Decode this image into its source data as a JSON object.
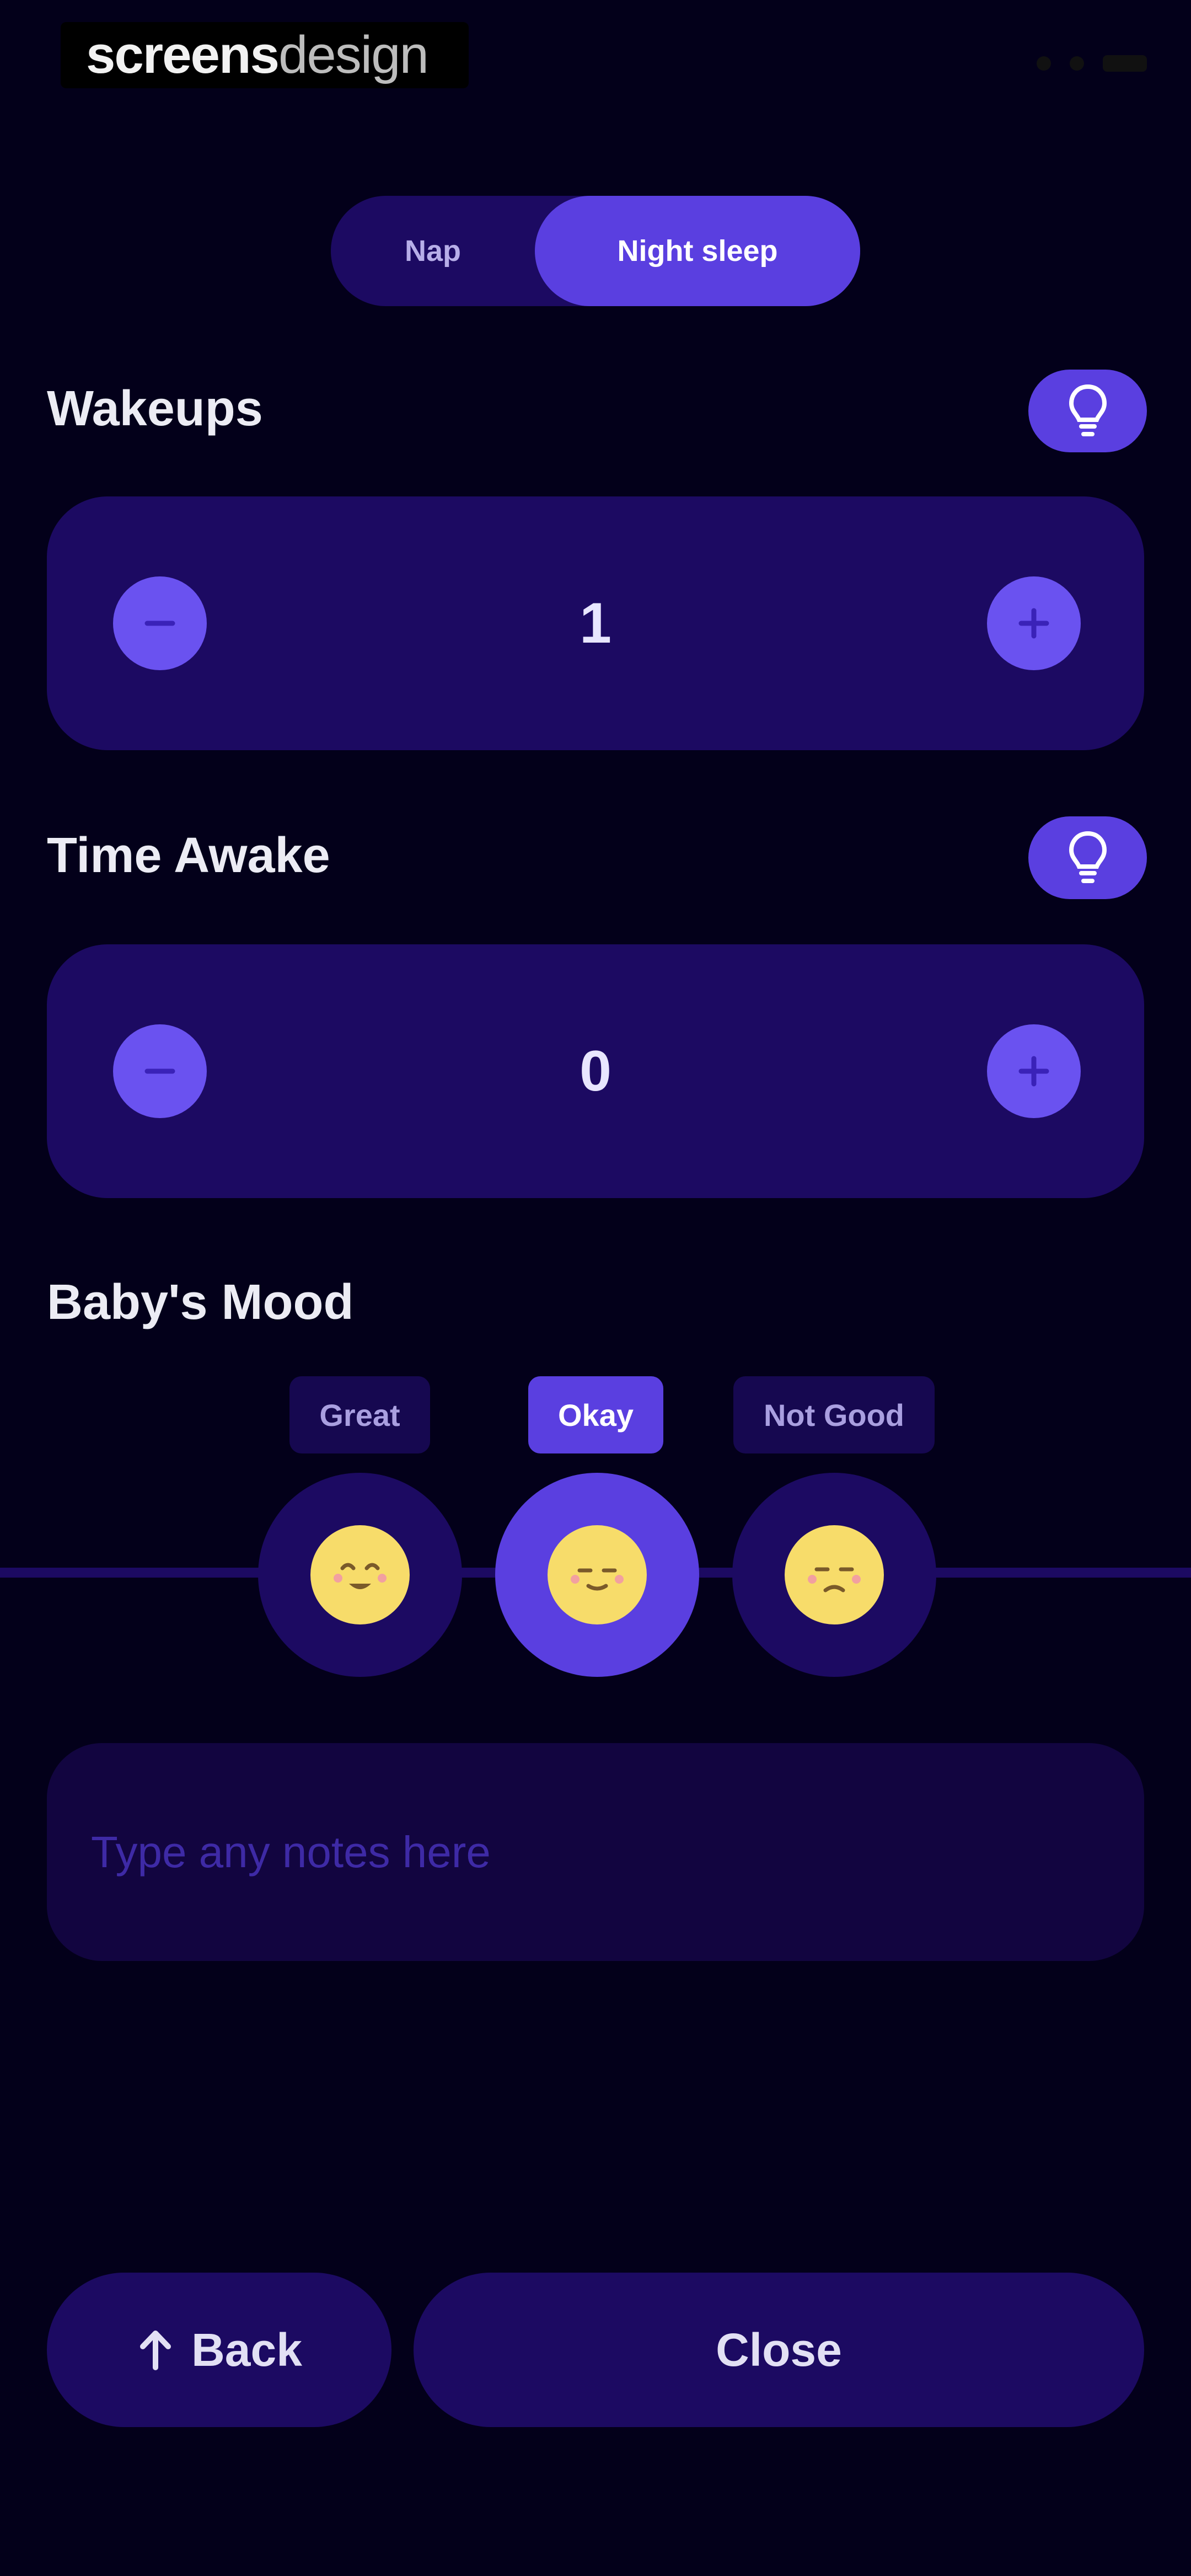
{
  "watermark": {
    "bold": "screens",
    "light": "design"
  },
  "toggle": {
    "options": [
      "Nap",
      "Night sleep"
    ],
    "selected": "Night sleep"
  },
  "wakeups": {
    "title": "Wakeups",
    "value": "1",
    "tip_icon": "lightbulb-icon"
  },
  "time_awake": {
    "title": "Time Awake",
    "value": "0",
    "tip_icon": "lightbulb-icon"
  },
  "mood": {
    "title": "Baby's Mood",
    "options": [
      {
        "label": "Great",
        "icon": "happy-face-icon"
      },
      {
        "label": "Okay",
        "icon": "neutral-face-icon"
      },
      {
        "label": "Not Good",
        "icon": "sad-face-icon"
      }
    ],
    "selected": "Okay"
  },
  "notes": {
    "placeholder": "Type any notes here"
  },
  "buttons": {
    "back": "Back",
    "close": "Close"
  },
  "colors": {
    "background": "#03001a",
    "card": "#1c0a62",
    "accent": "#5a3fe0",
    "face": "#f7dc6a"
  }
}
